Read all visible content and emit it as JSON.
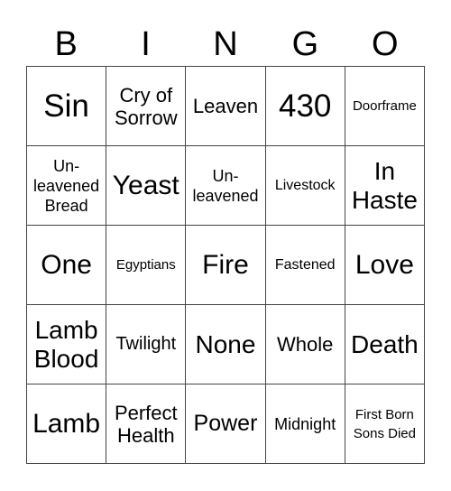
{
  "header": {
    "letters": [
      "B",
      "I",
      "N",
      "G",
      "O"
    ]
  },
  "cells": [
    [
      "Sin",
      "Cry of\nSorrow",
      "Leaven",
      "430",
      "Doorframe"
    ],
    [
      "Un-\nleavened\nBread",
      "Yeast",
      "Un-\nleavened",
      "Livestock",
      "In\nHaste"
    ],
    [
      "One",
      "Egyptians",
      "Fire",
      "Fastened",
      "Love"
    ],
    [
      "Lamb\nBlood",
      "Twilight",
      "None",
      "Whole",
      "Death"
    ],
    [
      "Lamb",
      "Perfect\nHealth",
      "Power",
      "Midnight",
      "First Born\nSons Died"
    ]
  ]
}
